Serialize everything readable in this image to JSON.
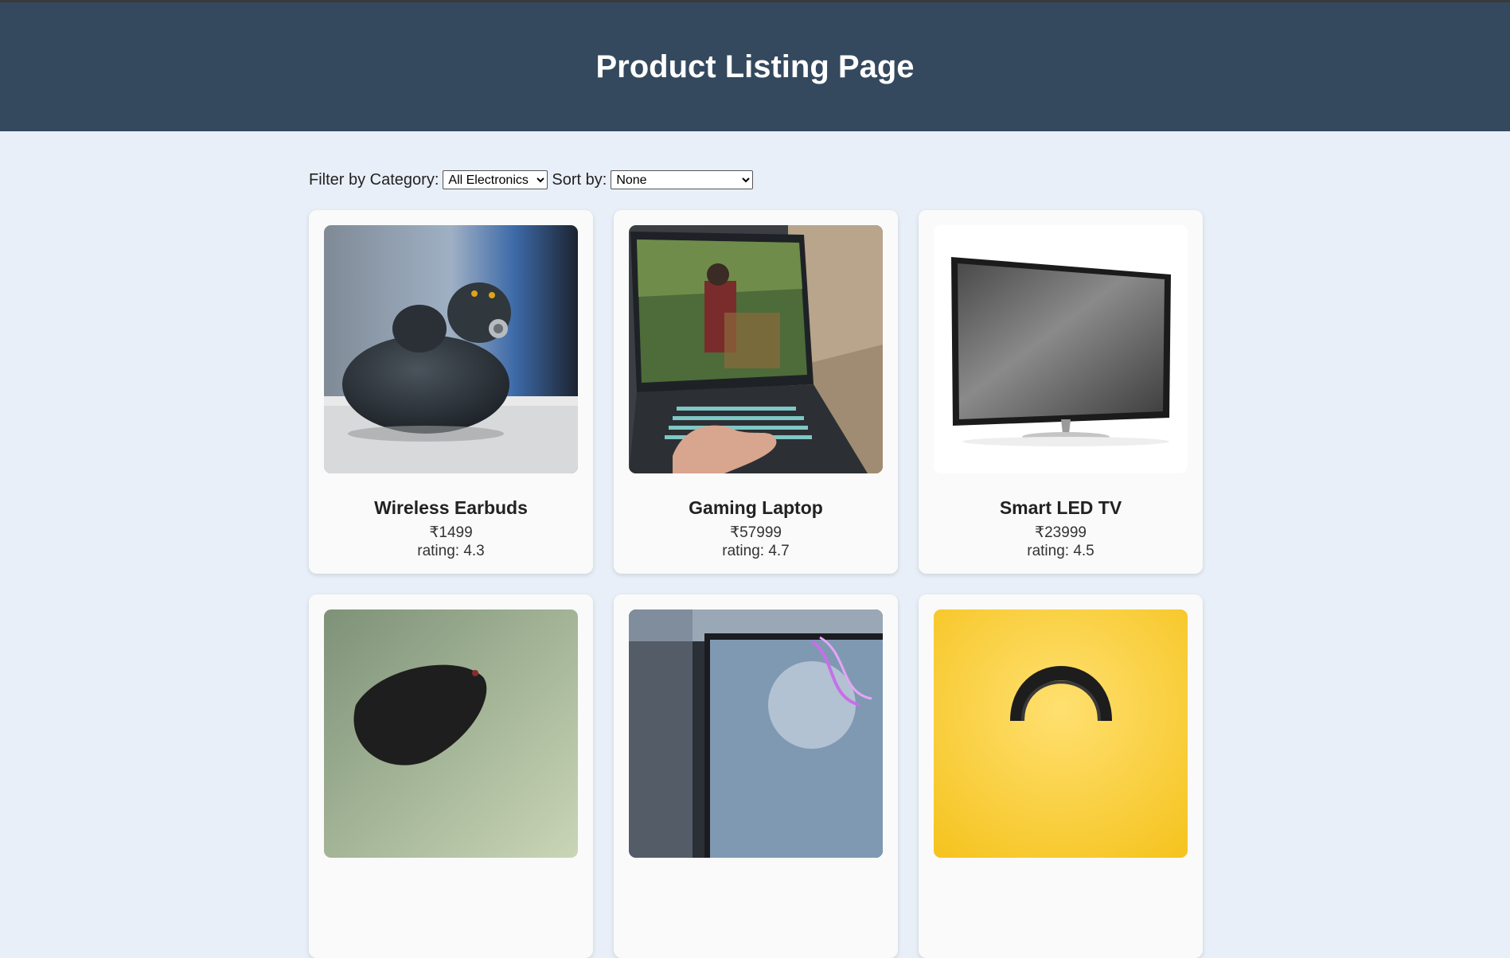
{
  "header": {
    "title": "Product Listing Page"
  },
  "filters": {
    "category_label": "Filter by Category:",
    "category_value": "All Electronics",
    "sort_label": "Sort by:",
    "sort_value": "None"
  },
  "products": [
    {
      "name": "Wireless Earbuds",
      "price": "₹1499",
      "rating": "rating: 4.3",
      "image": "earbuds-image"
    },
    {
      "name": "Gaming Laptop",
      "price": "₹57999",
      "rating": "rating: 4.7",
      "image": "laptop-image"
    },
    {
      "name": "Smart LED TV",
      "price": "₹23999",
      "rating": "rating: 4.5",
      "image": "tv-image"
    },
    {
      "name": "",
      "price": "",
      "rating": "",
      "image": "speaker-image"
    },
    {
      "name": "",
      "price": "",
      "rating": "",
      "image": "ultrabook-image"
    },
    {
      "name": "",
      "price": "",
      "rating": "",
      "image": "headphones-image"
    }
  ],
  "colors": {
    "header_bg": "#34495e",
    "page_bg": "#e8eff8",
    "card_bg": "#fafafa"
  }
}
